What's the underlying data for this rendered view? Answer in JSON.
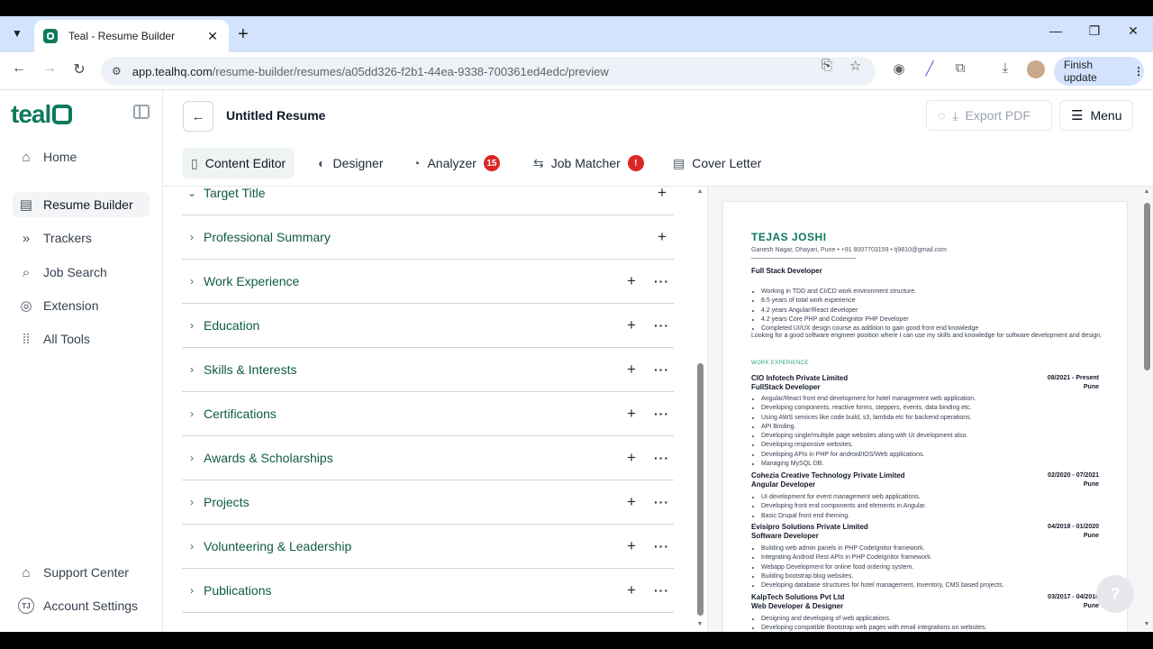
{
  "browser": {
    "tab_title": "Teal - Resume Builder",
    "url_host": "app.tealhq.com",
    "url_path": "/resume-builder/resumes/a05dd326-f2b1-44ea-9338-700361ed4edc/preview",
    "finish_update": "Finish update"
  },
  "sidebar": {
    "logo": "teal",
    "items": [
      {
        "label": "Home",
        "icon": "home-icon"
      },
      {
        "label": "Resume Builder",
        "icon": "document-icon"
      },
      {
        "label": "Trackers",
        "icon": "chevrons-icon"
      },
      {
        "label": "Job Search",
        "icon": "search-icon"
      },
      {
        "label": "Extension",
        "icon": "chrome-icon"
      },
      {
        "label": "All Tools",
        "icon": "grid-icon"
      }
    ],
    "bottom": [
      {
        "label": "Support Center",
        "icon": "graduation-icon"
      },
      {
        "label": "Account Settings",
        "icon": "avatar",
        "initials": "TJ"
      }
    ]
  },
  "header": {
    "title": "Untitled Resume",
    "export": "Export PDF",
    "menu": "Menu"
  },
  "tabs": [
    {
      "label": "Content Editor"
    },
    {
      "label": "Designer"
    },
    {
      "label": "Analyzer",
      "badge": "15"
    },
    {
      "label": "Job Matcher",
      "badge": "!"
    },
    {
      "label": "Cover Letter"
    }
  ],
  "sections": [
    {
      "label": "Target Title",
      "expanded": true
    },
    {
      "label": "Professional Summary"
    },
    {
      "label": "Work Experience"
    },
    {
      "label": "Education"
    },
    {
      "label": "Skills & Interests"
    },
    {
      "label": "Certifications"
    },
    {
      "label": "Awards & Scholarships"
    },
    {
      "label": "Projects"
    },
    {
      "label": "Volunteering & Leadership"
    },
    {
      "label": "Publications"
    }
  ],
  "resume": {
    "name": "TEJAS JOSHI",
    "contact": "Ganesh Nagar, Dhayari, Pune • +91 8007703159 • tj9810@gmail.com",
    "headline": "Full Stack Developer",
    "summary_bullets": [
      "Working in TDD and CI/CD work environment structure.",
      "8.5 years of total work experience",
      "4.2 years Angular/React developer",
      "4.2 years Core PHP and Codeignitor PHP Developer",
      "Completed UI/UX design course as addition to gain good front end knowledge"
    ],
    "summary_text": "Looking for a good software engineer position where I can use my skills and knowledge for software development and design.",
    "work_heading": "WORK EXPERIENCE",
    "jobs": [
      {
        "company": "CIO Infotech Private Limited",
        "role": "FullStack Developer",
        "dates": "08/2021 - Present",
        "location": "Pune",
        "bullets": [
          "Angular/React front end development for hotel management web application.",
          "Developing components, reactive forms, steppers, events, data binding etc.",
          "Using AWS services like code build, s3, lambda etc for backend operations.",
          "API Binding.",
          "Developing single/multiple page websites along with UI development also.",
          "Developing responsive websites.",
          "Developing APIs in PHP for android/IOS/Web applications.",
          "Managing MySQL DB."
        ]
      },
      {
        "company": "Cohezia Creative Technology Private Limited",
        "role": "Angular Developer",
        "dates": "02/2020 - 07/2021",
        "location": "Pune",
        "bullets": [
          "UI development for event management web applications.",
          "Developing front end components and elements in Angular.",
          "Basic Drupal front end theming."
        ]
      },
      {
        "company": "Evisipro Solutions Private Limited",
        "role": "Software Developer",
        "dates": "04/2018 - 01/2020",
        "location": "Pune",
        "bullets": [
          "Building web admin panels in PHP CodeIgnitor framework.",
          "Integrating Android Rest APIs in PHP CodeIgnitor framework.",
          "Webapp Development for online food ordering system.",
          "Building bootstrap blog websites.",
          "Developing database structures for hotel management, Inventory, CMS based projects."
        ]
      },
      {
        "company": "KalpTech Solutions Pvt Ltd",
        "role": "Web Developer & Designer",
        "dates": "03/2017 - 04/2018",
        "location": "Pune",
        "bullets": [
          "Designing and developing of web applications.",
          "Developing compatible Bootstrap web pages with email integrations on websites."
        ]
      }
    ]
  },
  "help": "?"
}
